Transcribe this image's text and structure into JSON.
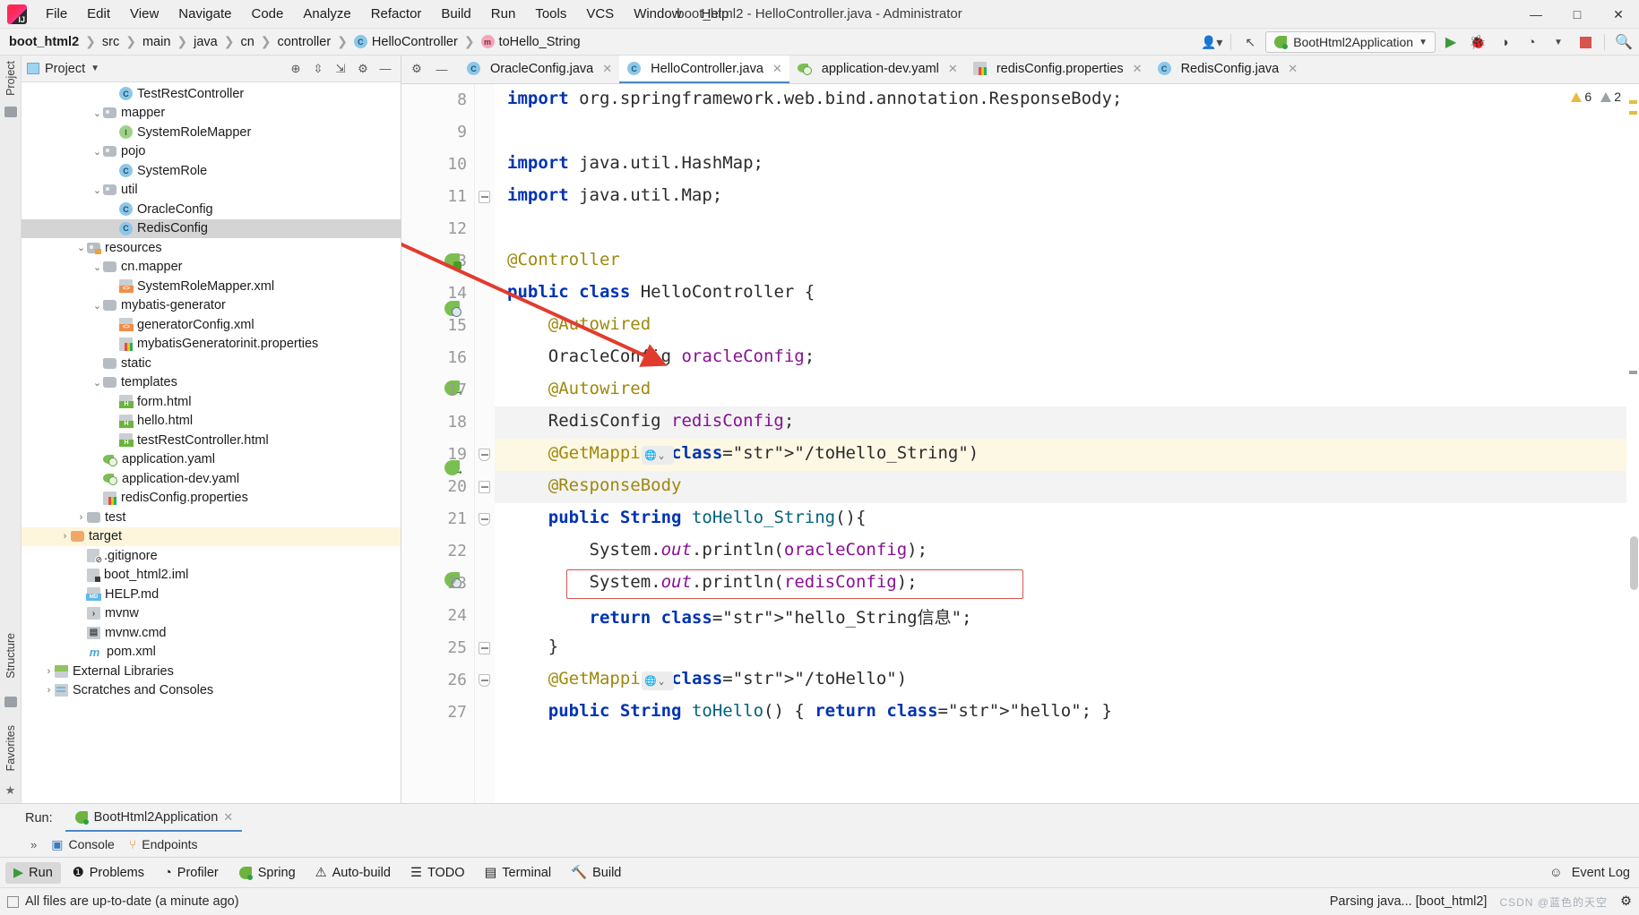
{
  "window": {
    "title": "boot_html2 - HelloController.java - Administrator",
    "minimize": "—",
    "maximize": "□",
    "close": "✕"
  },
  "menu": [
    {
      "label": "File"
    },
    {
      "label": "Edit"
    },
    {
      "label": "View"
    },
    {
      "label": "Navigate"
    },
    {
      "label": "Code"
    },
    {
      "label": "Analyze"
    },
    {
      "label": "Refactor"
    },
    {
      "label": "Build"
    },
    {
      "label": "Run"
    },
    {
      "label": "Tools"
    },
    {
      "label": "VCS"
    },
    {
      "label": "Window"
    },
    {
      "label": "Help"
    }
  ],
  "navbar": {
    "crumbs": [
      {
        "label": "boot_html2",
        "icon": "",
        "bold": true
      },
      {
        "label": "src",
        "icon": ""
      },
      {
        "label": "main",
        "icon": ""
      },
      {
        "label": "java",
        "icon": ""
      },
      {
        "label": "cn",
        "icon": ""
      },
      {
        "label": "controller",
        "icon": ""
      },
      {
        "label": "HelloController",
        "icon": "class-icon"
      },
      {
        "label": "toHello_String",
        "icon": "method-icon"
      }
    ],
    "run_config": "BootHtml2Application",
    "icons": [
      "user-icon",
      "back-arrow-icon",
      "run-icon",
      "debug-icon",
      "run-with-coverage-icon",
      "profiler-icon",
      "stop-icon",
      "search-icon"
    ]
  },
  "project_panel": {
    "title": "Project",
    "header_icons": [
      "locate-icon",
      "expand-all-icon",
      "collapse-all-icon",
      "settings-gear-icon",
      "hide-icon"
    ],
    "tree": [
      {
        "label": "TestRestController",
        "indent": 5,
        "icon": "class-icon",
        "arrow": ""
      },
      {
        "label": "mapper",
        "indent": 4,
        "icon": "folder-icon",
        "arrow": "v"
      },
      {
        "label": "SystemRoleMapper",
        "indent": 5,
        "icon": "interface-icon",
        "arrow": ""
      },
      {
        "label": "pojo",
        "indent": 4,
        "icon": "folder-icon",
        "arrow": "v"
      },
      {
        "label": "SystemRole",
        "indent": 5,
        "icon": "class-icon",
        "arrow": ""
      },
      {
        "label": "util",
        "indent": 4,
        "icon": "folder-icon",
        "arrow": "v"
      },
      {
        "label": "OracleConfig",
        "indent": 5,
        "icon": "class-icon",
        "arrow": ""
      },
      {
        "label": "RedisConfig",
        "indent": 5,
        "icon": "class-icon",
        "arrow": "",
        "state": "selected"
      },
      {
        "label": "resources",
        "indent": 3,
        "icon": "resources-folder-icon",
        "arrow": "v"
      },
      {
        "label": "cn.mapper",
        "indent": 4,
        "icon": "folder-plain-icon",
        "arrow": "v"
      },
      {
        "label": "SystemRoleMapper.xml",
        "indent": 5,
        "icon": "xml-icon",
        "arrow": ""
      },
      {
        "label": "mybatis-generator",
        "indent": 4,
        "icon": "folder-plain-icon",
        "arrow": "v"
      },
      {
        "label": "generatorConfig.xml",
        "indent": 5,
        "icon": "xml-icon",
        "arrow": ""
      },
      {
        "label": "mybatisGeneratorinit.properties",
        "indent": 5,
        "icon": "properties-icon",
        "arrow": ""
      },
      {
        "label": "static",
        "indent": 4,
        "icon": "folder-plain-icon",
        "arrow": ""
      },
      {
        "label": "templates",
        "indent": 4,
        "icon": "folder-plain-icon",
        "arrow": "v"
      },
      {
        "label": "form.html",
        "indent": 5,
        "icon": "html-icon",
        "arrow": ""
      },
      {
        "label": "hello.html",
        "indent": 5,
        "icon": "html-icon",
        "arrow": ""
      },
      {
        "label": "testRestController.html",
        "indent": 5,
        "icon": "html-icon",
        "arrow": ""
      },
      {
        "label": "application.yaml",
        "indent": 4,
        "icon": "yaml-icon",
        "arrow": ""
      },
      {
        "label": "application-dev.yaml",
        "indent": 4,
        "icon": "yaml-icon",
        "arrow": ""
      },
      {
        "label": "redisConfig.properties",
        "indent": 4,
        "icon": "properties-icon",
        "arrow": ""
      },
      {
        "label": "test",
        "indent": 3,
        "icon": "folder-plain-icon",
        "arrow": ">"
      },
      {
        "label": "target",
        "indent": 2,
        "icon": "folder-orange-icon",
        "arrow": ">",
        "state": "highlight"
      },
      {
        "label": ".gitignore",
        "indent": 3,
        "icon": "gitignore-icon",
        "arrow": ""
      },
      {
        "label": "boot_html2.iml",
        "indent": 3,
        "icon": "iml-icon",
        "arrow": ""
      },
      {
        "label": "HELP.md",
        "indent": 3,
        "icon": "markdown-icon",
        "arrow": ""
      },
      {
        "label": "mvnw",
        "indent": 3,
        "icon": "script-icon",
        "arrow": ""
      },
      {
        "label": "mvnw.cmd",
        "indent": 3,
        "icon": "cmd-icon",
        "arrow": ""
      },
      {
        "label": "pom.xml",
        "indent": 3,
        "icon": "maven-icon",
        "arrow": ""
      },
      {
        "label": "External Libraries",
        "indent": 1,
        "icon": "library-icon",
        "arrow": ">"
      },
      {
        "label": "Scratches and Consoles",
        "indent": 1,
        "icon": "scratch-icon",
        "arrow": ">"
      }
    ]
  },
  "rail": {
    "left_top_label": "Project",
    "left_bottom_labels": [
      "Structure",
      "Favorites"
    ]
  },
  "editor": {
    "tabs": [
      {
        "label": "OracleConfig.java",
        "icon": "class-icon",
        "active": false
      },
      {
        "label": "HelloController.java",
        "icon": "class-icon",
        "active": true
      },
      {
        "label": "application-dev.yaml",
        "icon": "yaml-icon",
        "active": false
      },
      {
        "label": "redisConfig.properties",
        "icon": "properties-icon",
        "active": false
      },
      {
        "label": "RedisConfig.java",
        "icon": "class-icon",
        "active": false
      }
    ],
    "inspection": {
      "warnings": "6",
      "weak_warnings": "2"
    },
    "lines": [
      {
        "n": "8",
        "text": "import org.springframework.web.bind.annotation.ResponseBody;"
      },
      {
        "n": "9",
        "text": ""
      },
      {
        "n": "10",
        "text": "import java.util.HashMap;"
      },
      {
        "n": "11",
        "text": "import java.util.Map;"
      },
      {
        "n": "12",
        "text": ""
      },
      {
        "n": "13",
        "text": "@Controller"
      },
      {
        "n": "14",
        "text": "public class HelloController {"
      },
      {
        "n": "15",
        "text": "    @Autowired"
      },
      {
        "n": "16",
        "text": "    OracleConfig oracleConfig;"
      },
      {
        "n": "17",
        "text": "    @Autowired"
      },
      {
        "n": "18",
        "text": "    RedisConfig redisConfig;"
      },
      {
        "n": "19",
        "text": "    @GetMapping(\"/toHello_String\")"
      },
      {
        "n": "20",
        "text": "    @ResponseBody"
      },
      {
        "n": "21",
        "text": "    public String toHello_String(){"
      },
      {
        "n": "22",
        "text": "        System.out.println(oracleConfig);"
      },
      {
        "n": "23",
        "text": "        System.out.println(redisConfig);"
      },
      {
        "n": "24",
        "text": "        return \"hello_String信息\";"
      },
      {
        "n": "25",
        "text": "    }"
      },
      {
        "n": "26",
        "text": "    @GetMapping(\"/toHello\")"
      },
      {
        "n": "27",
        "text": "    public String toHello() { return \"hello\"; }"
      }
    ]
  },
  "run_panel": {
    "label": "Run:",
    "config_name": "BootHtml2Application",
    "close": "✕",
    "more": "»",
    "subtabs": [
      {
        "label": "Console",
        "icon": "console-icon"
      },
      {
        "label": "Endpoints",
        "icon": "endpoints-icon"
      }
    ]
  },
  "toolstrip": {
    "items": [
      {
        "label": "Run",
        "icon": "run-icon",
        "active": true
      },
      {
        "label": "Problems",
        "icon": "problems-icon",
        "active": false
      },
      {
        "label": "Profiler",
        "icon": "profiler-icon",
        "active": false
      },
      {
        "label": "Spring",
        "icon": "spring-icon",
        "active": false
      },
      {
        "label": "Auto-build",
        "icon": "auto-build-icon",
        "active": false
      },
      {
        "label": "TODO",
        "icon": "todo-icon",
        "active": false
      },
      {
        "label": "Terminal",
        "icon": "terminal-icon",
        "active": false
      },
      {
        "label": "Build",
        "icon": "build-icon",
        "active": false
      }
    ],
    "right_label": "Event Log"
  },
  "status_bar": {
    "message": "All files are up-to-date (a minute ago)",
    "progress_text": "Parsing java... [boot_html2]",
    "watermark": "CSDN @蓝色的天空"
  },
  "colors": {
    "accent": "#4a88c7",
    "selection": "#d4d4d4",
    "highlight_row": "#fdf6dd",
    "annotation_red": "#e23b2e",
    "keyword": "#0033b3",
    "annotation": "#9e880d",
    "string": "#067d17",
    "field": "#871094"
  }
}
